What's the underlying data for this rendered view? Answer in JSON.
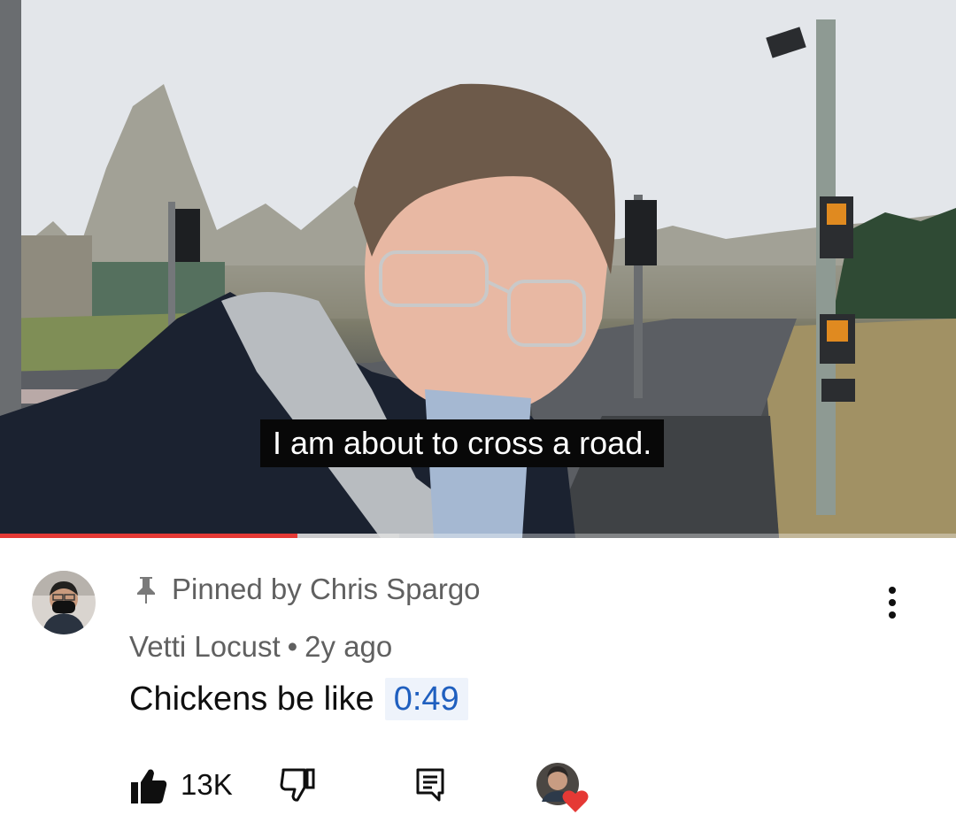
{
  "video": {
    "caption": "I am about to cross a road.",
    "progress_played": 0.311,
    "progress_buffered": 0.418,
    "progress_color": "#e53935"
  },
  "comment": {
    "pinned_label": "Pinned by Chris Spargo",
    "author": "Vetti Locust",
    "separator": "•",
    "age": "2y ago",
    "text": "Chickens be like",
    "timestamp_link": "0:49",
    "like_count": "13K",
    "icons": {
      "pin": "pin-icon",
      "more": "more-vert-icon",
      "like": "thumb-up-icon",
      "dislike": "thumb-down-icon",
      "reply": "reply-icon",
      "creator_heart": "creator-heart-icon"
    },
    "heart_color": "#e53935",
    "link_color": "#1f5fbf"
  }
}
